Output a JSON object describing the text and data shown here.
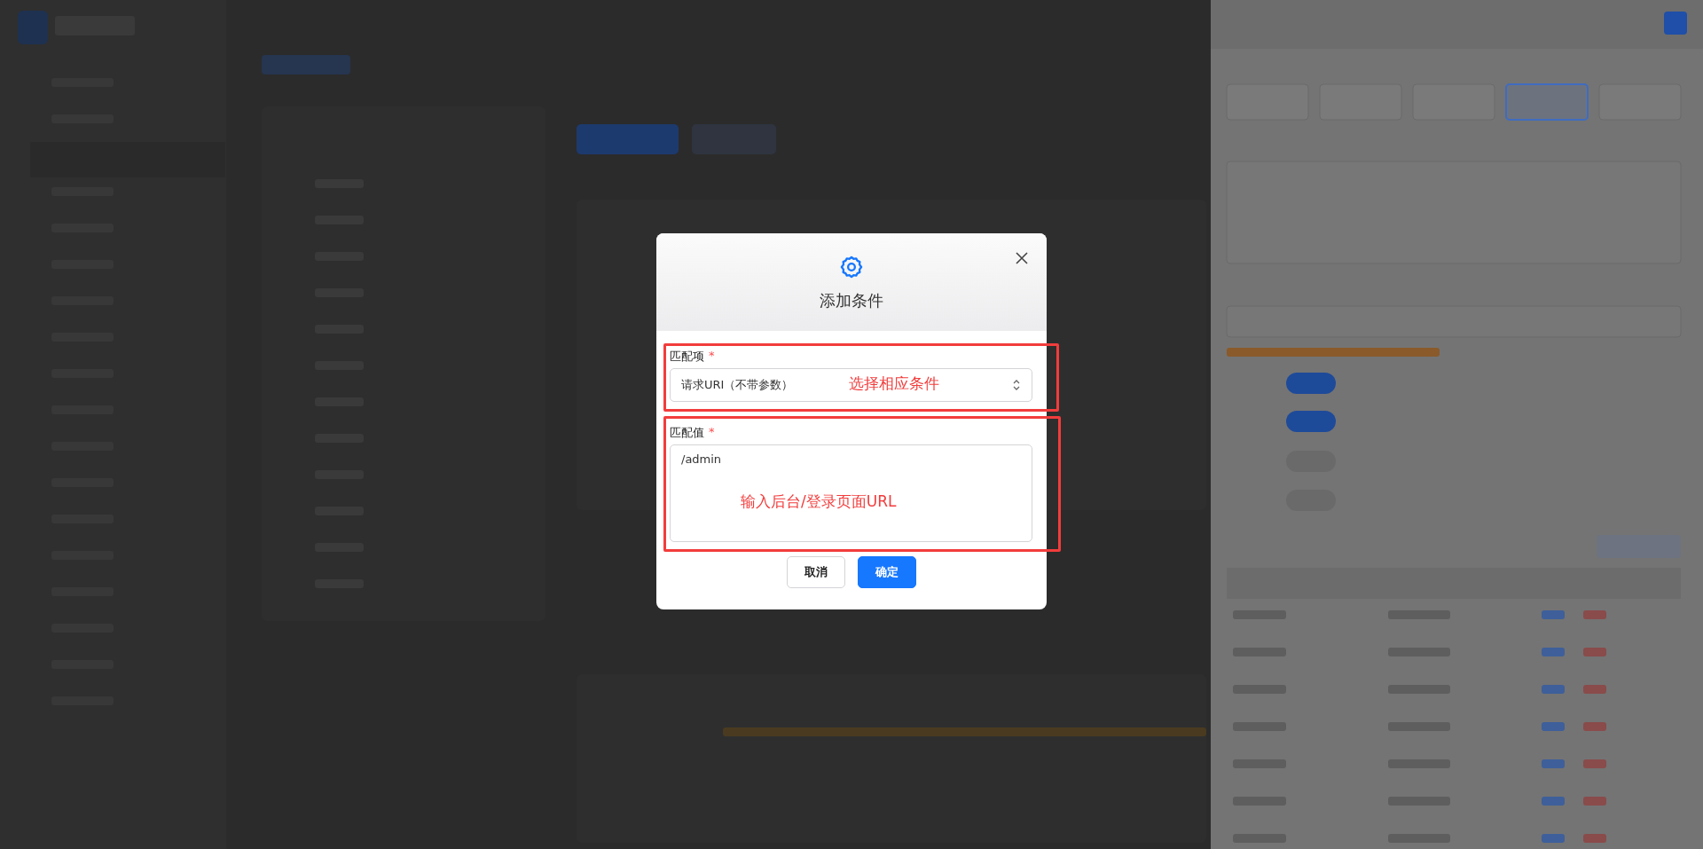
{
  "dialog": {
    "title": "添加条件",
    "fields": [
      {
        "kind": "select",
        "label": "匹配项",
        "required_mark": "*",
        "value": "请求URI（不带参数）"
      },
      {
        "kind": "textarea",
        "label": "匹配值",
        "required_mark": "*",
        "value": "/admin"
      }
    ],
    "buttons": [
      {
        "label": "取消",
        "kind": "default"
      },
      {
        "label": "确定",
        "kind": "primary"
      }
    ]
  },
  "annotations": [
    {
      "text": "选择相应条件"
    },
    {
      "text": "输入后台/登录页面URL"
    }
  ]
}
